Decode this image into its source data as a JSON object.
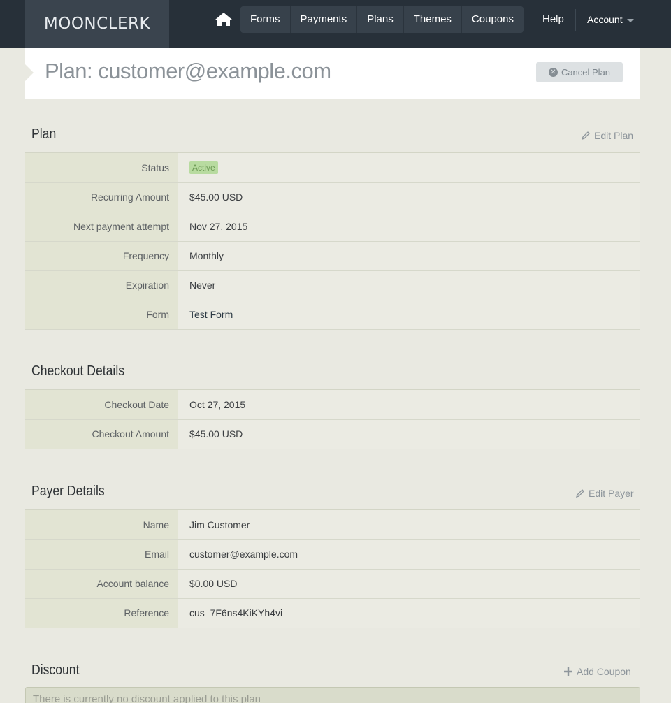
{
  "header": {
    "logo": "MOONCLERK",
    "nav": [
      "Forms",
      "Payments",
      "Plans",
      "Themes",
      "Coupons"
    ],
    "help": "Help",
    "account": "Account"
  },
  "page": {
    "title": "Plan: customer@example.com",
    "cancel_label": "Cancel Plan"
  },
  "plan": {
    "title": "Plan",
    "action": "Edit Plan",
    "rows": [
      {
        "label": "Status",
        "value": "Active"
      },
      {
        "label": "Recurring Amount",
        "value": "$45.00 USD"
      },
      {
        "label": "Next payment attempt",
        "value": "Nov 27, 2015"
      },
      {
        "label": "Frequency",
        "value": "Monthly"
      },
      {
        "label": "Expiration",
        "value": "Never"
      },
      {
        "label": "Form",
        "value": "Test Form"
      }
    ]
  },
  "checkout": {
    "title": "Checkout Details",
    "rows": [
      {
        "label": "Checkout Date",
        "value": "Oct 27, 2015"
      },
      {
        "label": "Checkout Amount",
        "value": "$45.00 USD"
      }
    ]
  },
  "payer": {
    "title": "Payer Details",
    "action": "Edit Payer",
    "rows": [
      {
        "label": "Name",
        "value": "Jim Customer"
      },
      {
        "label": "Email",
        "value": "customer@example.com"
      },
      {
        "label": "Account balance",
        "value": "$0.00 USD"
      },
      {
        "label": "Reference",
        "value": "cus_7F6ns4KiKYh4vi"
      }
    ]
  },
  "discount": {
    "title": "Discount",
    "action": "Add Coupon",
    "message": "There is currently no discount applied to this plan"
  },
  "colors": {
    "nav_bg": "#273039",
    "page_bg": "#e9e9e1",
    "label_bg": "#e2e4d3",
    "active_badge": "#b8dba0"
  }
}
